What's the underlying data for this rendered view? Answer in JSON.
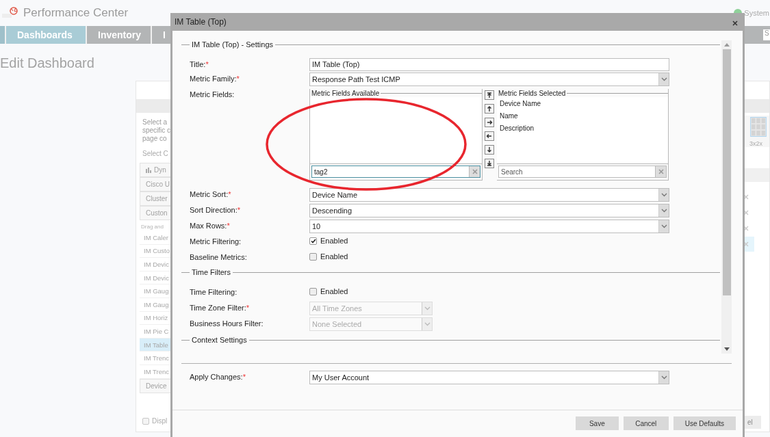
{
  "app": {
    "title": "Performance Center",
    "status": "System"
  },
  "nav": {
    "tabs": [
      {
        "label": "Dashboards",
        "selected": true
      },
      {
        "label": "Inventory",
        "selected": false
      },
      {
        "label": "I",
        "selected": false
      }
    ],
    "search_placeholder": "S"
  },
  "page": {
    "title": "Edit Dashboard"
  },
  "panel": {
    "intro_lines": [
      "Select a",
      "specific c",
      "page co"
    ],
    "select_label": "Select C",
    "items": [
      {
        "kind": "group",
        "label": "Dyn"
      },
      {
        "kind": "group",
        "label": "Cisco U"
      },
      {
        "kind": "group",
        "label": "Cluster"
      },
      {
        "kind": "group",
        "label": "Custon"
      },
      {
        "kind": "hint",
        "label": "Drag and"
      },
      {
        "kind": "item",
        "label": "IM Caler",
        "selected": false
      },
      {
        "kind": "item",
        "label": "IM Custo",
        "selected": false
      },
      {
        "kind": "item",
        "label": "IM Devic",
        "selected": false
      },
      {
        "kind": "item",
        "label": "IM Devic",
        "selected": false
      },
      {
        "kind": "item",
        "label": "IM Gaug",
        "selected": false
      },
      {
        "kind": "item",
        "label": "IM Gaug",
        "selected": false
      },
      {
        "kind": "item",
        "label": "IM Horiz",
        "selected": false
      },
      {
        "kind": "item",
        "label": "IM Pie C",
        "selected": false
      },
      {
        "kind": "item",
        "label": "IM Table",
        "selected": true
      },
      {
        "kind": "item",
        "label": "IM Trenc",
        "selected": false
      },
      {
        "kind": "item",
        "label": "IM Trenc",
        "selected": false
      },
      {
        "kind": "group",
        "label": "Device"
      }
    ],
    "display_option": {
      "label": "Displ",
      "checked": false
    },
    "layout_option": {
      "label": "3x2x"
    },
    "removable_rows": [
      {
        "selected": false
      },
      {
        "selected": false
      },
      {
        "selected": false
      },
      {
        "selected": true
      }
    ],
    "button": "el"
  },
  "dialog": {
    "title": "IM Table (Top)",
    "sections": [
      {
        "legend": "IM Table (Top) - Settings",
        "fields": [
          {
            "kind": "text",
            "label": "Title:",
            "required_mark": "*",
            "value": "IM Table (Top)"
          },
          {
            "kind": "select",
            "label": "Metric Family:",
            "required_mark": "*",
            "value": "Response Path Test ICMP",
            "disabled": false
          },
          {
            "kind": "dual_list",
            "label": "Metric Fields:",
            "available": {
              "legend": "Metric Fields Available",
              "search_value": "tag2"
            },
            "chosen": {
              "legend": "Metric Fields Selected",
              "items": [
                "Device Name",
                "Name",
                "Description"
              ],
              "search_placeholder": "Search"
            }
          },
          {
            "kind": "select",
            "label": "Metric Sort:",
            "required_mark": "*",
            "value": "Device Name",
            "disabled": false
          },
          {
            "kind": "select",
            "label": "Sort Direction:",
            "required_mark": "*",
            "value": "Descending",
            "disabled": false
          },
          {
            "kind": "select",
            "label": "Max Rows:",
            "required_mark": "*",
            "value": "10",
            "disabled": false
          },
          {
            "kind": "checkbox",
            "label": "Metric Filtering:",
            "option": "Enabled",
            "checked": true
          },
          {
            "kind": "checkbox",
            "label": "Baseline Metrics:",
            "option": "Enabled",
            "checked": false
          }
        ]
      },
      {
        "legend": "Time Filters",
        "fields": [
          {
            "kind": "checkbox",
            "label": "Time Filtering:",
            "option": "Enabled",
            "checked": false
          },
          {
            "kind": "select",
            "label": "Time Zone Filter:",
            "required_mark": "*",
            "value": "All Time Zones",
            "disabled": true
          },
          {
            "kind": "select",
            "label": "Business Hours Filter:",
            "value": "None Selected",
            "disabled": true
          }
        ]
      },
      {
        "legend": "Context Settings"
      }
    ],
    "apply": {
      "label": "Apply Changes:",
      "required_mark": "*",
      "value": "My User Account"
    },
    "buttons": [
      "Save",
      "Cancel",
      "Use Defaults"
    ]
  }
}
